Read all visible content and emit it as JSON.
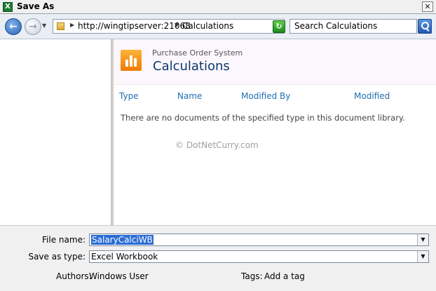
{
  "window": {
    "title": "Save As",
    "app_icon": "excel-icon",
    "close_glyph": "✕"
  },
  "navigation": {
    "back_icon": "back-arrow-icon",
    "forward_icon": "forward-arrow-icon",
    "address_crumbs": [
      "http://wingtipserver:21068",
      "Calculations"
    ],
    "search_placeholder": "Search Calculations"
  },
  "library": {
    "site_name": "Purchase Order System",
    "title": "Calculations",
    "columns": [
      "Type",
      "Name",
      "Modified By",
      "Modified"
    ],
    "empty_message": "There are no documents of the specified type in this document library.",
    "watermark": "© DotNetCurry.com"
  },
  "form": {
    "file_name_label": "File name:",
    "file_name_value": "SalaryCalciWB",
    "save_type_label": "Save as type:",
    "save_type_value": "Excel Workbook",
    "authors_label": "Authors:",
    "authors_value": "Windows User",
    "tags_label": "Tags:",
    "tags_value": "Add a tag"
  },
  "colors": {
    "accent_blue": "#1f6fb2",
    "title_blue": "#0b3a6a",
    "logo_orange": "#f07a00",
    "selection": "#2a6cd6"
  }
}
